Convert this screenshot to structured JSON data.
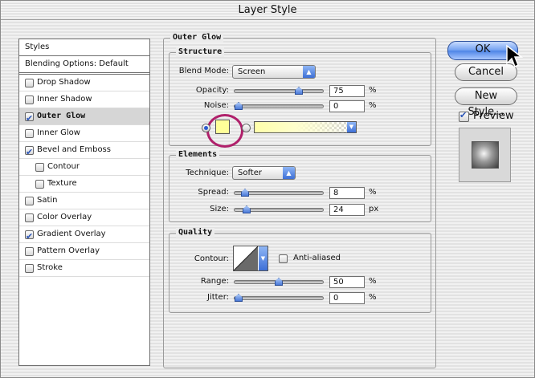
{
  "window": {
    "title": "Layer Style"
  },
  "styles_list": {
    "header": "Styles",
    "blending": "Blending Options: Default",
    "items": [
      {
        "label": "Drop Shadow",
        "checked": false,
        "indent": false,
        "selected": false
      },
      {
        "label": "Inner Shadow",
        "checked": false,
        "indent": false,
        "selected": false
      },
      {
        "label": "Outer Glow",
        "checked": true,
        "indent": false,
        "selected": true
      },
      {
        "label": "Inner Glow",
        "checked": false,
        "indent": false,
        "selected": false
      },
      {
        "label": "Bevel and Emboss",
        "checked": true,
        "indent": false,
        "selected": false
      },
      {
        "label": "Contour",
        "checked": false,
        "indent": true,
        "selected": false
      },
      {
        "label": "Texture",
        "checked": false,
        "indent": true,
        "selected": false
      },
      {
        "label": "Satin",
        "checked": false,
        "indent": false,
        "selected": false
      },
      {
        "label": "Color Overlay",
        "checked": false,
        "indent": false,
        "selected": false
      },
      {
        "label": "Gradient Overlay",
        "checked": true,
        "indent": false,
        "selected": false
      },
      {
        "label": "Pattern Overlay",
        "checked": false,
        "indent": false,
        "selected": false
      },
      {
        "label": "Stroke",
        "checked": false,
        "indent": false,
        "selected": false
      }
    ]
  },
  "outer_glow": {
    "title": "Outer Glow",
    "structure": {
      "title": "Structure",
      "blend_mode_label": "Blend Mode:",
      "blend_mode_value": "Screen",
      "opacity_label": "Opacity:",
      "opacity_value": "75",
      "opacity_unit": "%",
      "opacity_level": 0.75,
      "noise_label": "Noise:",
      "noise_value": "0",
      "noise_unit": "%",
      "noise_level": 0,
      "color_swatch": "#ffff99"
    },
    "elements": {
      "title": "Elements",
      "technique_label": "Technique:",
      "technique_value": "Softer",
      "spread_label": "Spread:",
      "spread_value": "8",
      "spread_unit": "%",
      "spread_level": 0.08,
      "size_label": "Size:",
      "size_value": "24",
      "size_unit": "px",
      "size_level": 0.1
    },
    "quality": {
      "title": "Quality",
      "contour_label": "Contour:",
      "anti_aliased_label": "Anti-aliased",
      "anti_aliased_checked": false,
      "range_label": "Range:",
      "range_value": "50",
      "range_unit": "%",
      "range_level": 0.5,
      "jitter_label": "Jitter:",
      "jitter_value": "0",
      "jitter_unit": "%",
      "jitter_level": 0
    }
  },
  "buttons": {
    "ok": "OK",
    "cancel": "Cancel",
    "new_style": "New Style...",
    "preview_label": "Preview",
    "preview_checked": true
  },
  "colors": {
    "accent": "#4d84e6",
    "highlight_ring": "#b0206b",
    "glow_color": "#ffff99"
  }
}
